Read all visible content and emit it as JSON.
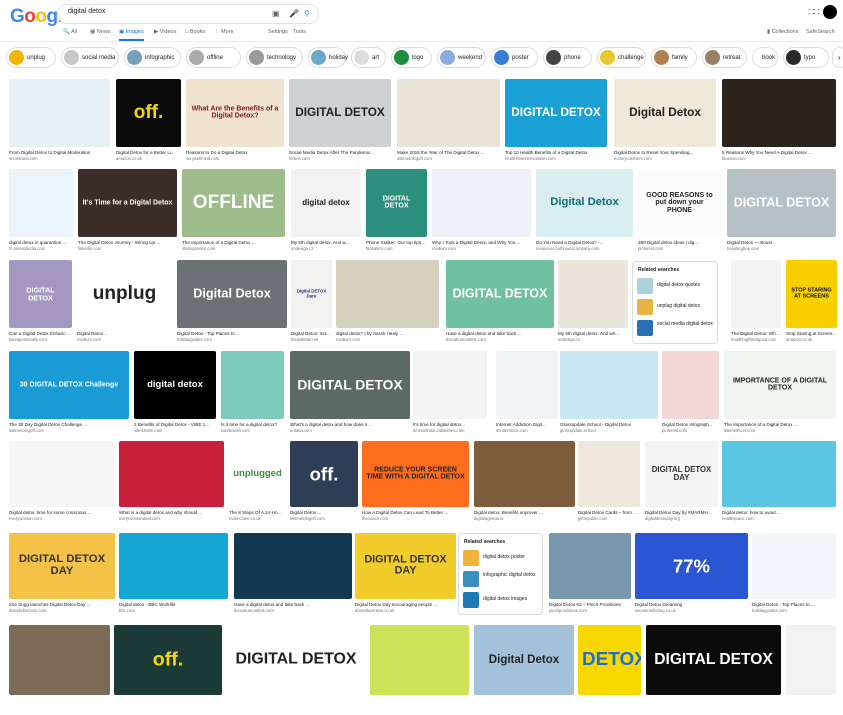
{
  "logo": "Google",
  "search": {
    "query": "digital detox"
  },
  "tabs": [
    "All",
    "News",
    "Images",
    "Videos",
    "Books",
    "More"
  ],
  "tools": [
    "Settings",
    "Tools"
  ],
  "right_tools": [
    "Collections",
    "SafeSearch"
  ],
  "chips": [
    "unplug",
    "social media",
    "infographic",
    "offline",
    "technology",
    "holiday",
    "art",
    "logo",
    "weekend",
    "poster",
    "phone",
    "challenge",
    "family",
    "retreat",
    "book",
    "typo"
  ],
  "results": [
    {
      "cap": "From Digital Detox to Digital Moderation",
      "src": "shortstand.com"
    },
    {
      "cap": "Digital Detox for a Better Li...",
      "src": "amazon.co.uk",
      "ov": "off."
    },
    {
      "cap": "Reasons to Do a Digital Detox",
      "src": "verywellmind.com",
      "ov": "What Are the Benefits of a Digital Detox?"
    },
    {
      "cap": "Social Media Detox After The Pandemic...",
      "src": "forbes.com",
      "ov": "DIGITAL DETOX"
    },
    {
      "cap": "Make 2018 the Year of The Digital Detox ...",
      "src": "itstimetologoff.com"
    },
    {
      "cap": "Top 10 Health Benefits of a Digital Detox",
      "src": "healthfitnessrevolution.com",
      "ov": "DIGITAL DETOX"
    },
    {
      "cap": "Digital Detox to Reset Your Spending...",
      "src": "moneycrashers.com",
      "ov": "Digital Detox"
    },
    {
      "cap": "5 Reasons Why You Need A Digital Detox ...",
      "src": "bluecoa.com"
    },
    {
      "cap": "digital detox in quarantine ...",
      "src": "m.timesofindia.com"
    },
    {
      "cap": "The Digital Detox Journey - Wiring Up ...",
      "src": "linkedin.com",
      "ov": "It's Time for a Digital Detox"
    },
    {
      "cap": "The Importance of a Digital Detox ...",
      "src": "startupnation.com",
      "ov": "OFFLINE"
    },
    {
      "cap": "My 5th digital detox. And w...",
      "src": "undesign.cz",
      "ov": "digital detox"
    },
    {
      "cap": "Phone Stalker: Our top tips f...",
      "src": "biobaltics.com",
      "ov": "DIGITAL DETOX"
    },
    {
      "cap": "Why I Took a Digital Detox, and Why You ...",
      "src": "medium.com"
    },
    {
      "cap": "Do You Need a Digital Detox? -...",
      "src": "resources.buffiniandcompany.com",
      "ov": "Digital Detox"
    },
    {
      "cap": "380 Digital detox ideas | dig...",
      "src": "pinterest.com",
      "ov": "GOOD REASONS to put down your PHONE"
    },
    {
      "cap": "Digital Detox — Boost",
      "src": "boostingfree.com",
      "ov": "DIGITAL DETOX"
    },
    {
      "cap": "Can a Digital Detox Enhance ...",
      "src": "takeitpersonally.com",
      "ov": "DIGITAL DETOX"
    },
    {
      "cap": "Digital Detox ...",
      "src": "medium.com",
      "ov": "unplug"
    },
    {
      "cap": "Digital Detox - Top Places to ...",
      "src": "holidayguides.com",
      "ov": "Digital Detox"
    },
    {
      "cap": "Digital Detox: mission failed ...",
      "src": "thedalitstar.net",
      "ov": "Digital DETOX Dare"
    },
    {
      "cap": "digital detox? | by Sarah Healy ...",
      "src": "medium.com"
    },
    {
      "cap": "Have a digital detox and take back ...",
      "src": "thecultureoutlets.com",
      "ov": "DIGITAL DETOX"
    },
    {
      "cap": "My 5th digital detox. And wh...",
      "src": "undesign.cz"
    },
    {
      "cap": "The Digital Detox: What...",
      "src": "healthhighlitedgood.com"
    },
    {
      "cap": "Stop Staring at Screen...",
      "src": "amazon.co.uk",
      "ov": "STOP STARING AT SCREENS"
    },
    {
      "cap": "The 30 Day Digital Detox Challenge ...",
      "src": "itstimetologoff.com",
      "ov": "30 DIGITAL DETOX Challenge"
    },
    {
      "cap": "3 Benefits of Digital Detox - VIBE 1...",
      "src": "vibe105fm.com",
      "ov": "digital detox"
    },
    {
      "cap": "Is it time for a digital detox?",
      "src": "katebowell.com"
    },
    {
      "cap": "What's a digital detox and how does it ...",
      "src": "erdatia.com",
      "ov": "DIGITAL DETOX"
    },
    {
      "cap": "It's time for digital detox...",
      "src": "timesofindia.indiatimes.com"
    },
    {
      "cap": "Internet Addiction Digit...",
      "src": "shutterstock.com"
    },
    {
      "cap": "Glossopdale School - Digital Detox",
      "src": "glossopdale.school"
    },
    {
      "cap": "Digital Detox Infograph...",
      "src": "pinterest.com"
    },
    {
      "cap": "The Importance of a Digital Detox ...",
      "src": "itisentofficer.com",
      "ov": "IMPORTANCE OF A DIGITAL DETOX"
    },
    {
      "cap": "Digital detox: time for some conscious ...",
      "src": "everywoman.com"
    },
    {
      "cap": "What is a digital detox and why should ...",
      "src": "everywomandeal.com"
    },
    {
      "cap": "The 8 Steps Of A 24-Ho...",
      "src": "marieclaire.co.uk",
      "ov": "unplugged"
    },
    {
      "cap": "Digital Detox ...",
      "src": "itstimetologoff.com",
      "ov": "off."
    },
    {
      "cap": "How A Digital Detox Can Lead To Better ...",
      "src": "thecoach.com",
      "ov": "REDUCE YOUR SCREEN TIME WITH A DIGITAL DETOX"
    },
    {
      "cap": "Digital detox: Benefits unprover ...",
      "src": "digitalagenda.io"
    },
    {
      "cap": "Digital Detox Cards – from ...",
      "src": "giftrepublic.com"
    },
    {
      "cap": "Digital Detox Day by #MARMH...",
      "src": "digitaldetoxday.org",
      "ov": "DIGITAL DETOX DAY"
    },
    {
      "cap": "Digital detox: how to avoid ...",
      "src": "healthspace.com"
    },
    {
      "cap": "Zoe Sugg launches Digital Detox Day ...",
      "src": "dianybdirectory.com",
      "ov": "DIGITAL DETOX DAY"
    },
    {
      "cap": "Digital detox - BBC Worklife",
      "src": "bbc.com"
    },
    {
      "cap": "Have a digital detox and take back ...",
      "src": "thecultureoutlets.com"
    },
    {
      "cap": "Digital Detox Day encouraging people ...",
      "src": "dorsetbusiness.co.uk",
      "ov": "DIGITAL DETOX DAY"
    },
    {
      "cap": "Digital Detox Kit – Pinch Provisions",
      "src": "pinchprovisions.com"
    },
    {
      "cap": "Digital Detox Dreaming",
      "src": "weeatmarketing.co.uk",
      "ov": "77%"
    },
    {
      "cap": "Digital Detox - Top Places to ...",
      "src": "holidayguides.com"
    },
    {
      "cap": "",
      "src": ""
    },
    {
      "cap": "",
      "src": "",
      "ov": "off."
    },
    {
      "cap": "",
      "src": "",
      "ov": "DIGITAL DETOX"
    },
    {
      "cap": "",
      "src": ""
    },
    {
      "cap": "",
      "src": "",
      "ov": "Digital Detox"
    },
    {
      "cap": "",
      "src": "",
      "ov": "DETOX"
    },
    {
      "cap": "",
      "src": "",
      "ov": "DIGITAL DETOX"
    },
    {
      "cap": "",
      "src": ""
    }
  ],
  "related": [
    {
      "title": "Related searches",
      "items": [
        "digital detox quotes",
        "unplug digital detox",
        "social media digital detox"
      ]
    },
    {
      "title": "Related searches",
      "items": [
        "digital detox poster",
        "infographic digital detox",
        "digital detox images"
      ]
    }
  ],
  "colors": {
    "blue": "#4285f4",
    "red": "#ea4335",
    "yellow": "#fbbc05",
    "green": "#34a853",
    "accent": "#1a73e8"
  }
}
